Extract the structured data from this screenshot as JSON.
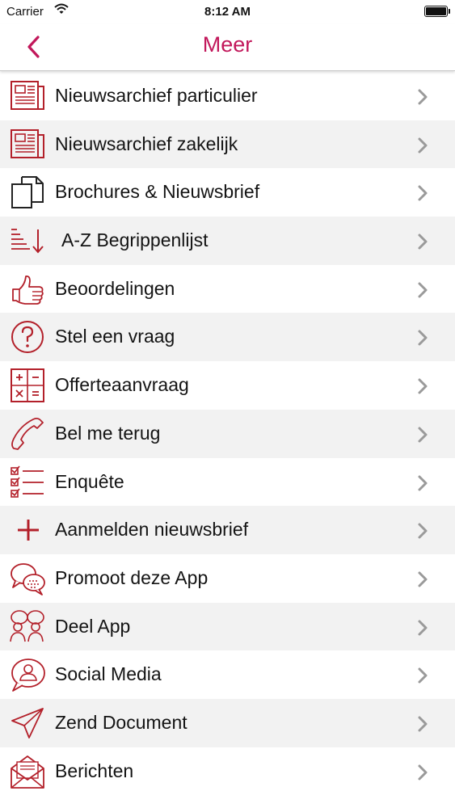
{
  "status": {
    "carrier": "Carrier",
    "time": "8:12 AM"
  },
  "nav": {
    "title": "Meer"
  },
  "accent_color": "#c2185b",
  "icon_color": "#b3202a",
  "items": [
    {
      "label": "Nieuwsarchief particulier",
      "icon": "newspaper-icon"
    },
    {
      "label": "Nieuwsarchief zakelijk",
      "icon": "newspaper-icon"
    },
    {
      "label": "Brochures & Nieuwsbrief",
      "icon": "documents-icon"
    },
    {
      "label": "A-Z Begrippenlijst",
      "icon": "sort-list-icon"
    },
    {
      "label": "Beoordelingen",
      "icon": "thumbs-up-icon"
    },
    {
      "label": "Stel een vraag",
      "icon": "question-icon"
    },
    {
      "label": "Offerteaanvraag",
      "icon": "calculator-icon"
    },
    {
      "label": "Bel me terug",
      "icon": "phone-icon"
    },
    {
      "label": "Enquête",
      "icon": "checklist-icon"
    },
    {
      "label": "Aanmelden nieuwsbrief",
      "icon": "plus-icon"
    },
    {
      "label": "Promoot deze App",
      "icon": "speech-bubbles-icon"
    },
    {
      "label": "Deel App",
      "icon": "people-icon"
    },
    {
      "label": "Social Media",
      "icon": "user-bubble-icon"
    },
    {
      "label": "Zend Document",
      "icon": "send-icon"
    },
    {
      "label": "Berichten",
      "icon": "envelope-icon"
    }
  ]
}
